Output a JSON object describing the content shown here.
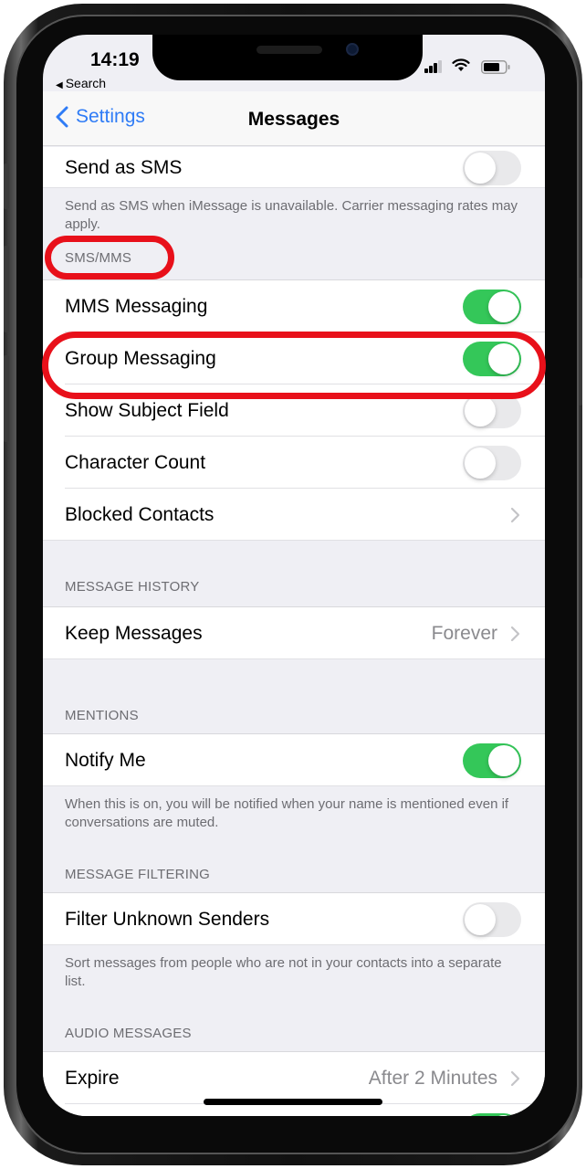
{
  "status_bar": {
    "time": "14:19",
    "back_app": "Search"
  },
  "nav": {
    "back_label": "Settings",
    "title": "Messages"
  },
  "colors": {
    "accent": "#2f7cf6",
    "toggle_on": "#34c759",
    "annotation": "#e8101a"
  },
  "rows": {
    "send_as_sms": {
      "label": "Send as SMS",
      "on": false
    },
    "send_as_sms_footer": "Send as SMS when iMessage is unavailable. Carrier messaging rates may apply.",
    "sms_mms_header": "SMS/MMS",
    "mms_messaging": {
      "label": "MMS Messaging",
      "on": true
    },
    "group_messaging": {
      "label": "Group Messaging",
      "on": true
    },
    "show_subject_field": {
      "label": "Show Subject Field",
      "on": false
    },
    "character_count": {
      "label": "Character Count",
      "on": false
    },
    "blocked_contacts": {
      "label": "Blocked Contacts"
    },
    "message_history_header": "MESSAGE HISTORY",
    "keep_messages": {
      "label": "Keep Messages",
      "value": "Forever"
    },
    "mentions_header": "MENTIONS",
    "notify_me": {
      "label": "Notify Me",
      "on": true
    },
    "notify_me_footer": "When this is on, you will be notified when your name is mentioned even if conversations are muted.",
    "message_filtering_header": "MESSAGE FILTERING",
    "filter_unknown": {
      "label": "Filter Unknown Senders",
      "on": false
    },
    "filter_unknown_footer": "Sort messages from people who are not in your contacts into a separate list.",
    "audio_messages_header": "AUDIO MESSAGES",
    "expire": {
      "label": "Expire",
      "value": "After 2 Minutes"
    },
    "partial_row": {
      "on": true
    }
  }
}
